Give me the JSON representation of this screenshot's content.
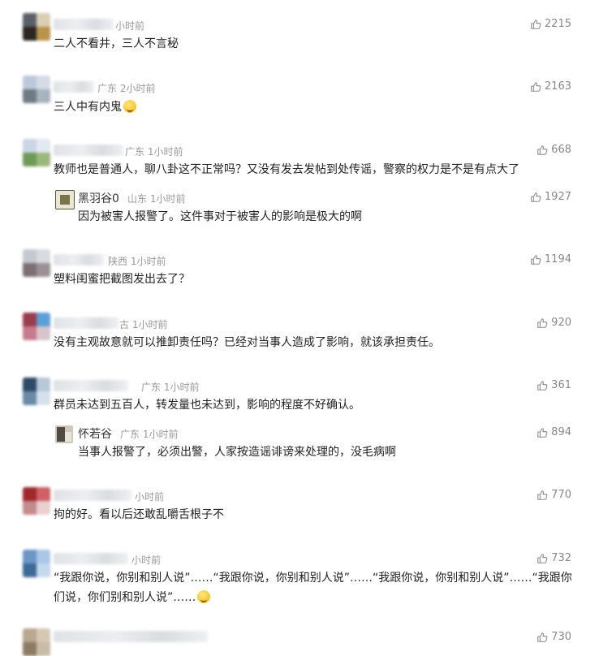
{
  "comments": [
    {
      "meta": "小时前",
      "text": "二人不看井，三人不言秘",
      "likes": "2215"
    },
    {
      "meta": "广东 2小时前",
      "text": "三人中有内鬼",
      "likes": "2163"
    },
    {
      "meta": "广东 1小时前",
      "text": "教师也是普通人，聊八卦这不正常吗？又没有发去发帖到处传谣，警察的权力是不是有点大了",
      "likes": "668",
      "reply": {
        "name": "黑羽谷0",
        "meta": "山东 1小时前",
        "text": "因为被害人报警了。这件事对于被害人的影响是极大的啊",
        "likes": "1927"
      }
    },
    {
      "meta": "陕西 1小时前",
      "text": "塑料闺蜜把截图发出去了？",
      "likes": "1194"
    },
    {
      "meta": "古 1小时前",
      "text": "没有主观故意就可以推卸责任吗？已经对当事人造成了影响，就该承担责任。",
      "likes": "920"
    },
    {
      "meta": "广东 1小时前",
      "text": "群员未达到五百人，转发量也未达到，影响的程度不好确认。",
      "likes": "361",
      "reply": {
        "name": "怀若谷",
        "meta": "广东 1小时前",
        "text": "当事人报警了，必须出警，人家按造谣诽谤来处理的，没毛病啊",
        "likes": "894"
      }
    },
    {
      "meta": "小时前",
      "text": "拘的好。看以后还敢乱嚼舌根子不",
      "likes": "770"
    },
    {
      "meta": "小时前",
      "text": "“我跟你说，你别和别人说”……“我跟你说，你别和别人说”……“我跟你说，你别和别人说”……“我跟你们说，你们别和别人说”……",
      "likes": "732"
    },
    {
      "meta": "",
      "text": "",
      "likes": "730"
    }
  ],
  "icons": {
    "like": "thumbs-up-icon",
    "emoji": "emoji-icon"
  }
}
